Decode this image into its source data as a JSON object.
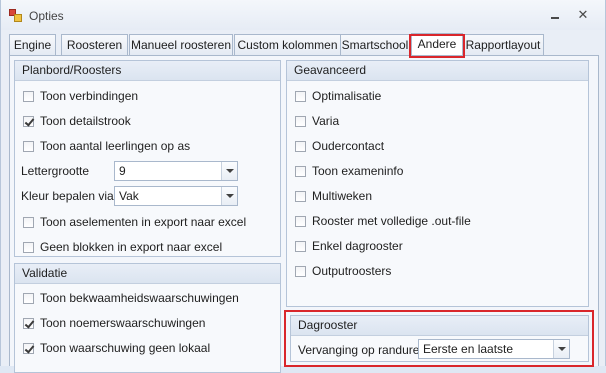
{
  "window": {
    "title": "Opties"
  },
  "tabs": [
    {
      "label": "Engine"
    },
    {
      "label": "Roosteren"
    },
    {
      "label": "Manueel roosteren"
    },
    {
      "label": "Custom kolommen"
    },
    {
      "label": "Smartschool"
    },
    {
      "label": "Andere",
      "active": true
    },
    {
      "label": "Rapportlayout"
    }
  ],
  "planbord": {
    "header": "Planbord/Roosters",
    "checkboxes": [
      {
        "label": "Toon verbindingen",
        "checked": false
      },
      {
        "label": "Toon detailstrook",
        "checked": true
      },
      {
        "label": "Toon aantal leerlingen op as",
        "checked": false
      }
    ],
    "lettergrootte_label": "Lettergrootte",
    "lettergrootte_value": "9",
    "kleur_label": "Kleur bepalen via",
    "kleur_value": "Vak",
    "checkboxes2": [
      {
        "label": "Toon aselementen in export naar excel",
        "checked": false
      },
      {
        "label": "Geen blokken in export naar excel",
        "checked": false
      }
    ]
  },
  "validatie": {
    "header": "Validatie",
    "checkboxes": [
      {
        "label": "Toon bekwaamheidswaarschuwingen",
        "checked": false
      },
      {
        "label": "Toon noemerswaarschuwingen",
        "checked": true
      },
      {
        "label": "Toon waarschuwing geen lokaal",
        "checked": true
      }
    ]
  },
  "geavanceerd": {
    "header": "Geavanceerd",
    "checkboxes": [
      {
        "label": "Optimalisatie",
        "checked": false
      },
      {
        "label": "Varia",
        "checked": false
      },
      {
        "label": "Oudercontact",
        "checked": false
      },
      {
        "label": "Toon exameninfo",
        "checked": false
      },
      {
        "label": "Multiweken",
        "checked": false
      },
      {
        "label": "Rooster met volledige .out-file",
        "checked": false
      },
      {
        "label": "Enkel dagrooster",
        "checked": false
      },
      {
        "label": "Outputroosters",
        "checked": false
      }
    ]
  },
  "dagrooster": {
    "header": "Dagrooster",
    "vervanging_label": "Vervanging op randuren:",
    "vervanging_value": "Eerste en laatste"
  },
  "colors": {
    "highlight": "#d9262b",
    "background": "#e9eef6"
  },
  "icons": {
    "app": "opties-app-icon",
    "minimize": "minimize-icon",
    "close": "close-icon",
    "dropdown": "chevron-down-icon"
  }
}
